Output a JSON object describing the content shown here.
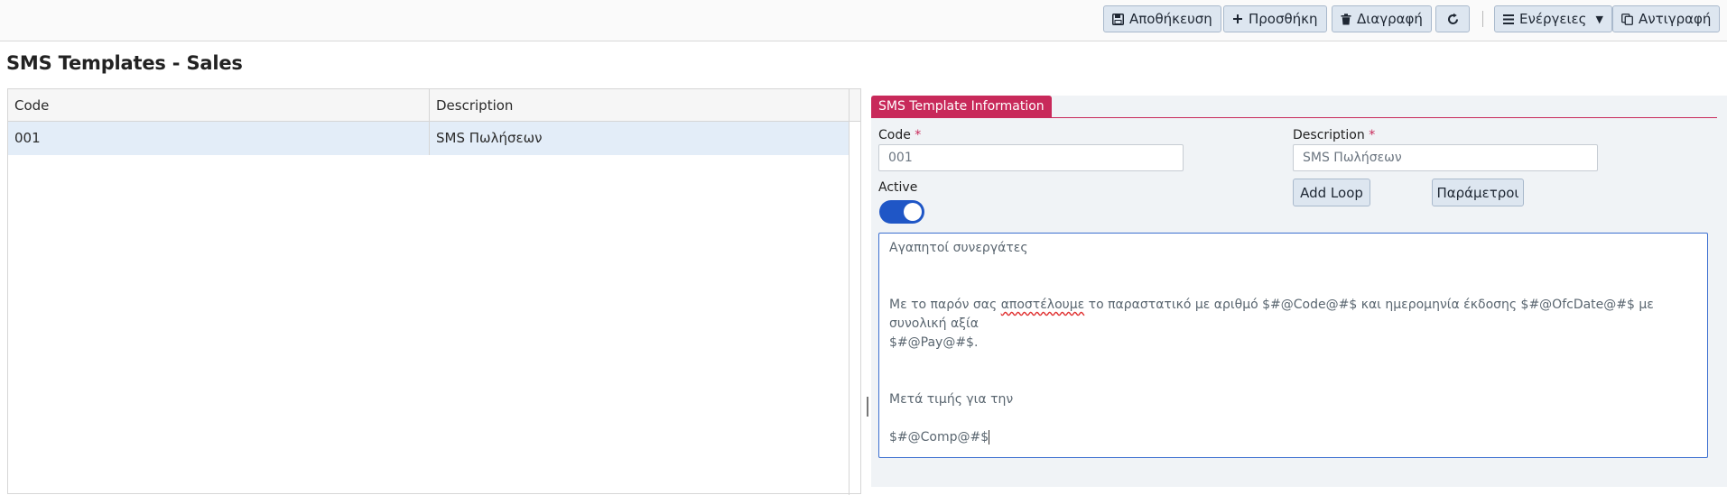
{
  "toolbar": {
    "save_label": "Αποθήκευση",
    "add_label": "Προσθήκη",
    "delete_label": "Διαγραφή",
    "actions_label": "Ενέργειες",
    "copy_label": "Αντιγραφή"
  },
  "page_title": "SMS Templates - Sales",
  "grid": {
    "columns": [
      "Code",
      "Description"
    ],
    "rows": [
      {
        "code": "001",
        "description": "SMS Πωλήσεων"
      }
    ]
  },
  "form": {
    "tab_label": "SMS Template Information",
    "code_label": "Code",
    "code_value": "001",
    "description_label": "Description",
    "description_value": "SMS Πωλήσεων",
    "required_mark": "*",
    "active_label": "Active",
    "active": true,
    "add_loop_label": "Add Loop",
    "parameters_label": "Παράμετροι",
    "body": {
      "greeting": "Αγαπητοί συνεργάτες",
      "line2_before": "Με το παρόν σας ",
      "line2_misspelled": "αποστέλουμε",
      "line2_after": " το παραστατικό με αριθμό $#@Code@#$ και ημερομηνία έκδοσης $#@OfcDate@#$ με συνολική αξία",
      "line3": "$#@Pay@#$.",
      "closing": "Μετά τιμής για την",
      "signature": "$#@Comp@#$"
    }
  },
  "colors": {
    "accent": "#c8295a",
    "toggle_on": "#1f56c6",
    "selected_row": "#e3edf8",
    "button_bg": "#dde6f0"
  }
}
